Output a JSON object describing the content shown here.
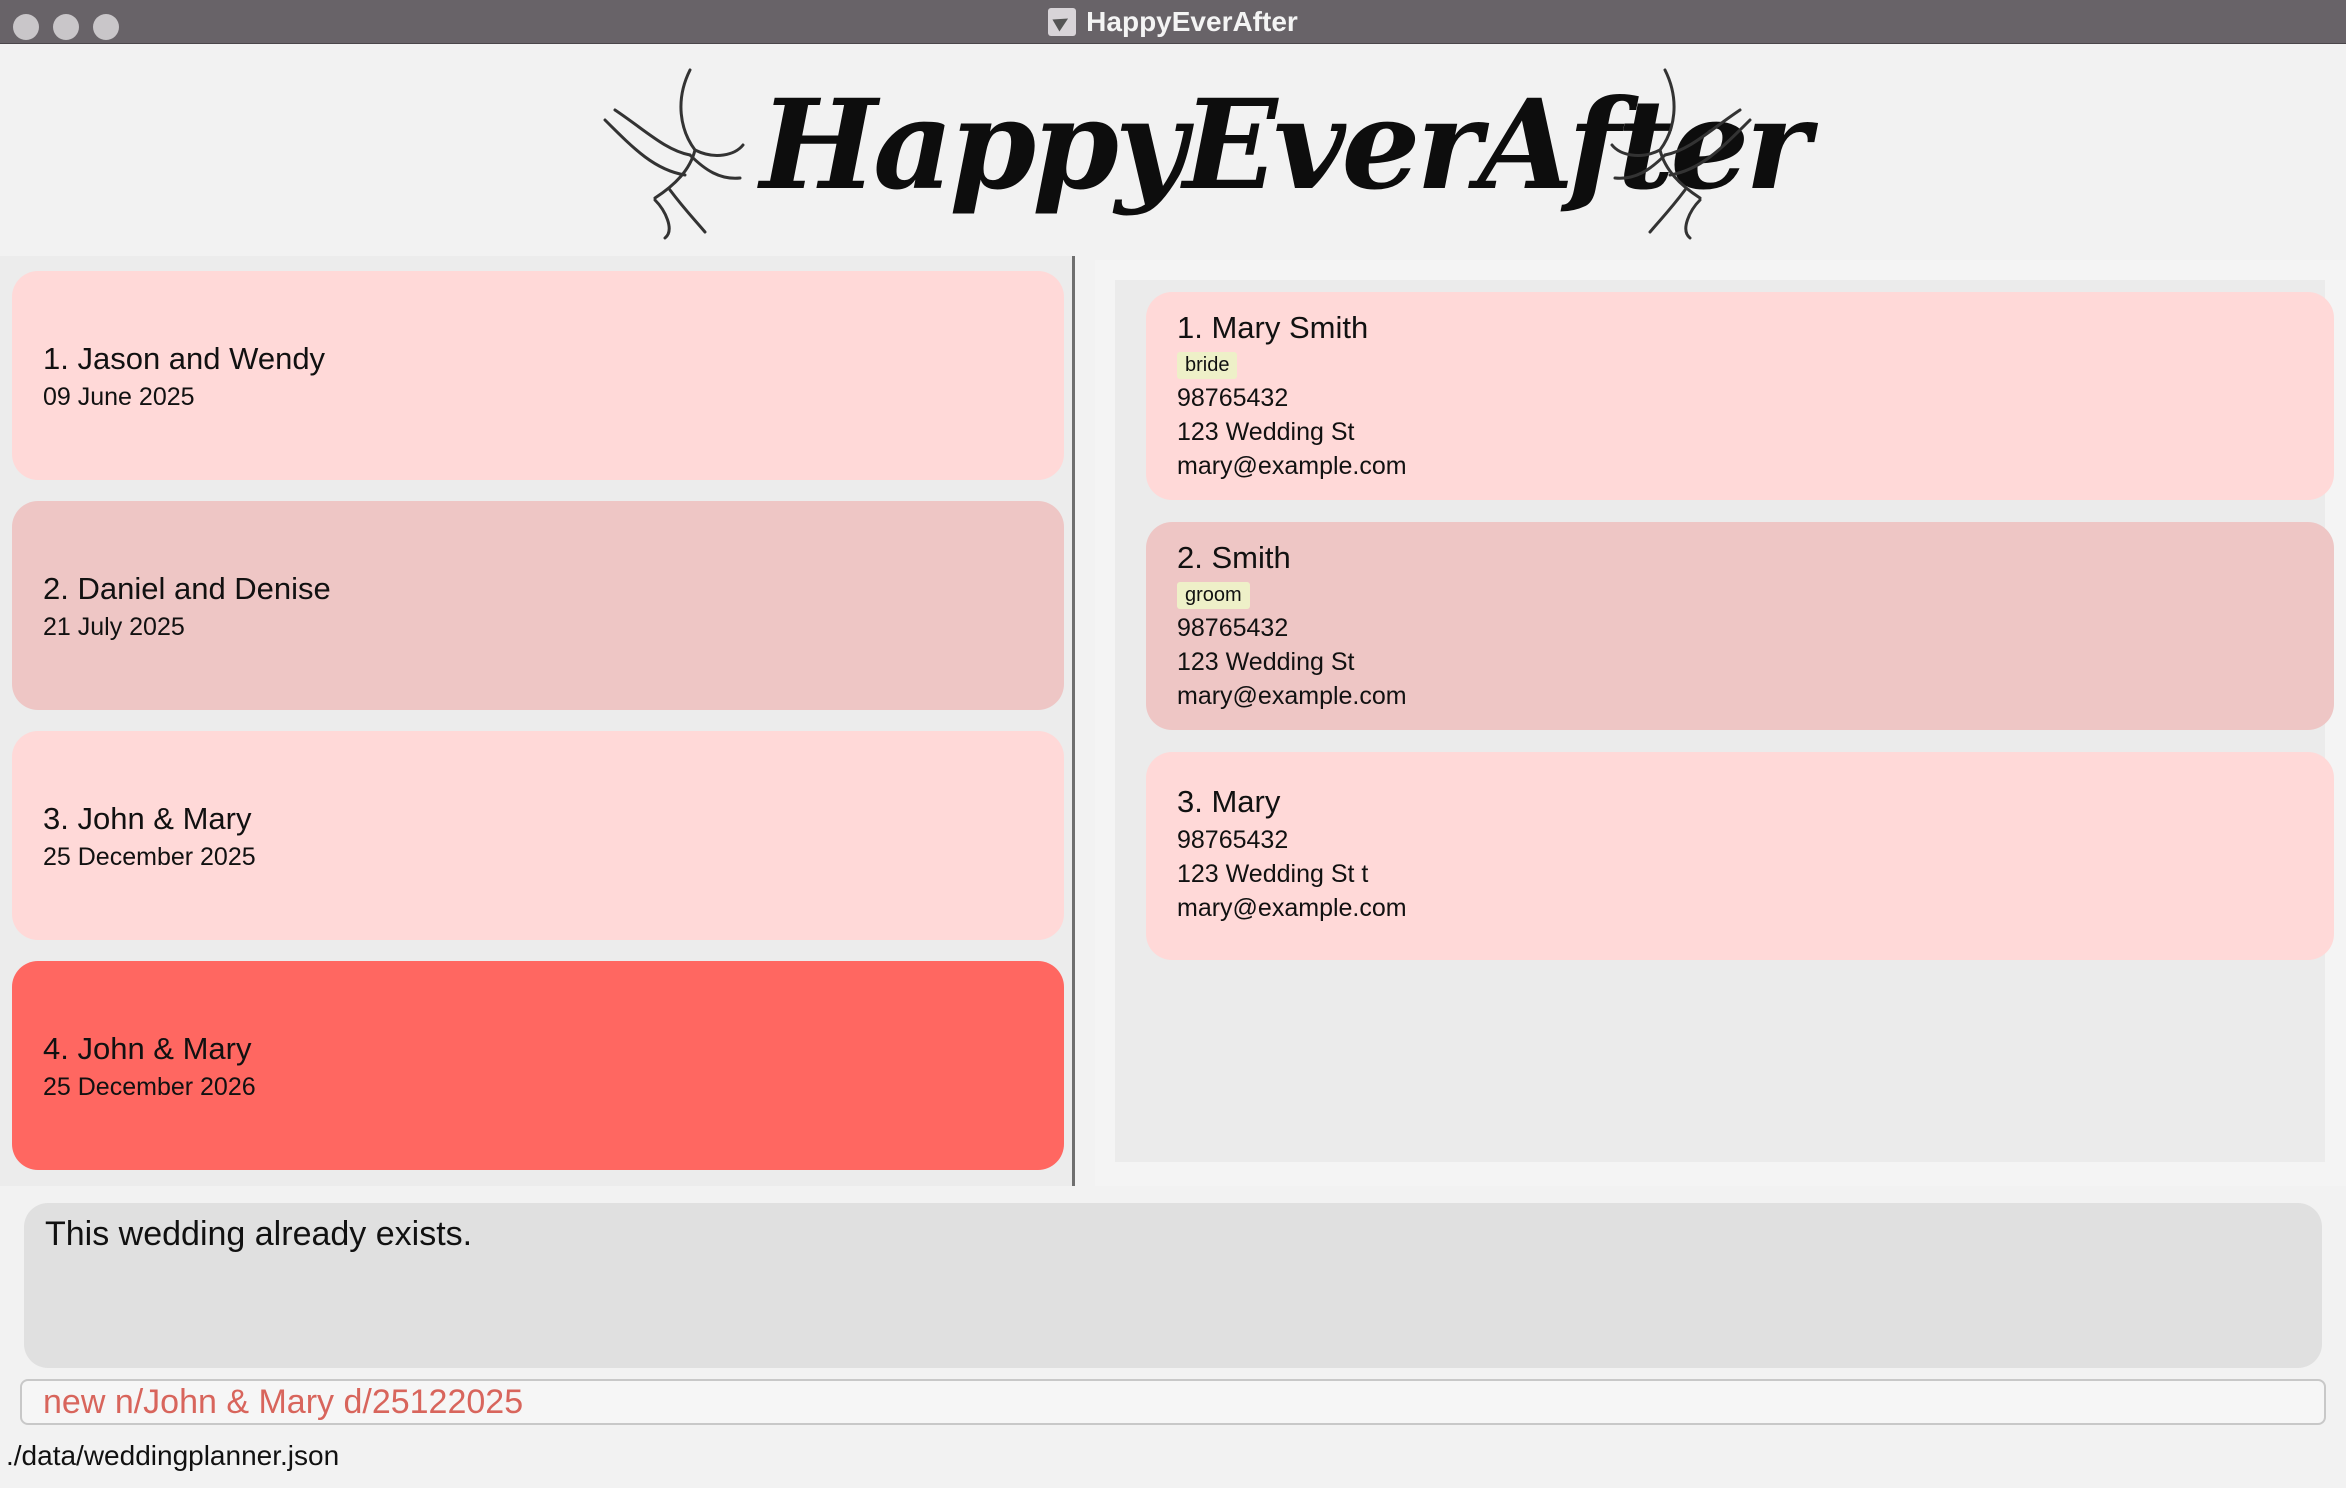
{
  "window": {
    "title": "HappyEverAfter"
  },
  "header": {
    "logo_text": "HappyEverAfter"
  },
  "weddings": [
    {
      "title": "1. Jason and Wendy",
      "date": "09 June 2025"
    },
    {
      "title": "2. Daniel and Denise",
      "date": "21 July 2025"
    },
    {
      "title": "3. John & Mary",
      "date": "25 December 2025"
    },
    {
      "title": "4. John & Mary",
      "date": "25 December 2026"
    }
  ],
  "persons": [
    {
      "name": "1. Mary Smith",
      "tag": "bride",
      "phone": "98765432",
      "address": "123 Wedding St",
      "email": "mary@example.com"
    },
    {
      "name": "2. Smith",
      "tag": "groom",
      "phone": "98765432",
      "address": "123 Wedding St",
      "email": "mary@example.com"
    },
    {
      "name": "3. Mary",
      "phone": "98765432",
      "address": "123 Wedding St t",
      "email": "mary@example.com"
    }
  ],
  "result": {
    "message": "This wedding already exists."
  },
  "command": {
    "value": "new n/John & Mary d/25122025"
  },
  "status": {
    "path": "./data/weddingplanner.json"
  },
  "colors": {
    "card_light": "#ffd9d8",
    "card_dark": "#eec6c5",
    "card_selected": "#ff6761",
    "command_text": "#d8655c"
  }
}
